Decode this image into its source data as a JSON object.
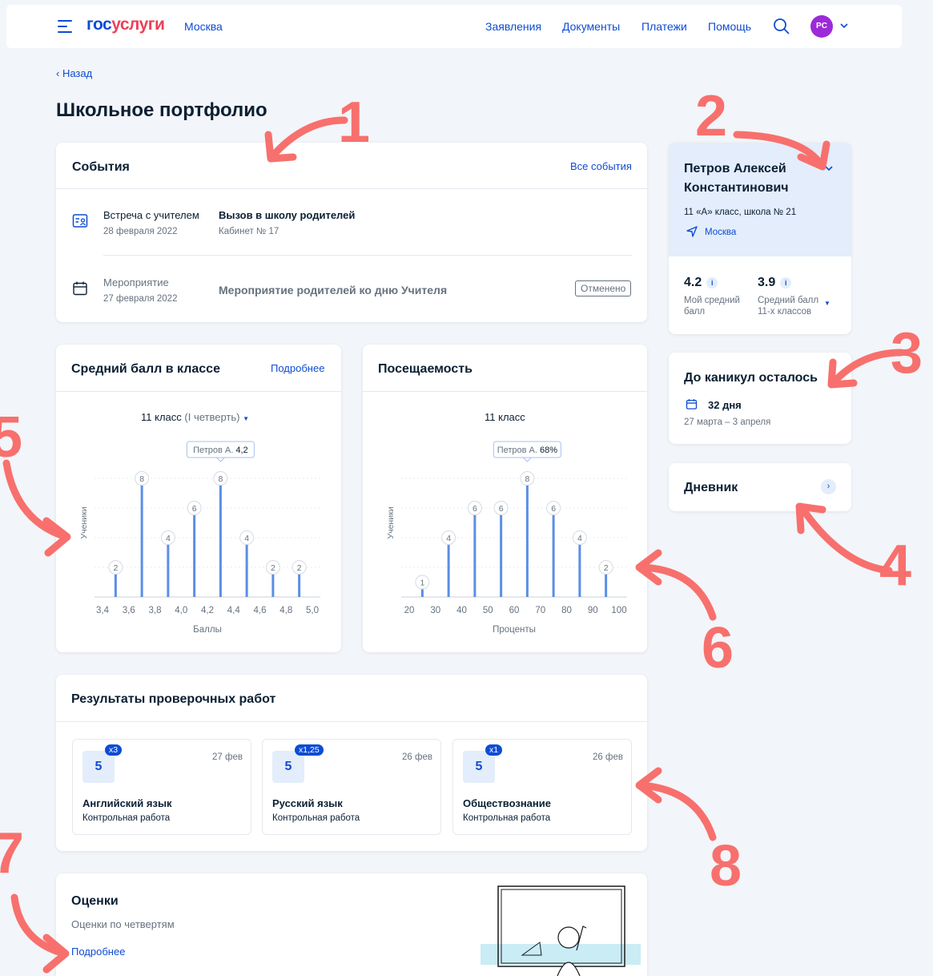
{
  "header": {
    "logo_part1": "гос",
    "logo_part2": "услуги",
    "city": "Москва",
    "nav": [
      "Заявления",
      "Документы",
      "Платежи",
      "Помощь"
    ],
    "avatar_initials": "PC"
  },
  "back_label": "Назад",
  "page_title": "Школьное портфолио",
  "events": {
    "title": "События",
    "all_link": "Все события",
    "items": [
      {
        "type": "Встреча с учителем",
        "date": "28 февраля 2022",
        "title": "Вызов в школу родителей",
        "sub": "Кабинет № 17"
      },
      {
        "type": "Мероприятие",
        "date": "27 февраля 2022",
        "title": "Мероприятие родителей ко дню Учителя",
        "status": "Отменено"
      }
    ]
  },
  "profile": {
    "name_line1": "Петров Алексей",
    "name_line2": "Константинович",
    "school": "11 «А» класс, школа № 21",
    "city": "Москва",
    "my_avg_value": "4.2",
    "my_avg_label_line1": "Мой средний",
    "my_avg_label_line2": "балл",
    "class_avg_value": "3.9",
    "class_avg_label_line1": "Средний балл",
    "class_avg_label_line2": "11-х классов"
  },
  "vacation": {
    "title": "До каникул осталось",
    "days": "32 дня",
    "range": "27 марта – 3 апреля"
  },
  "diary": {
    "title": "Дневник"
  },
  "grade_chart_card": {
    "title": "Средний балл в классе",
    "more": "Подробнее",
    "class_label": "11 класс",
    "quarter": "(I четверть)"
  },
  "attendance_card": {
    "title": "Посещаемость",
    "class_label": "11 класс"
  },
  "chart_data": [
    {
      "type": "bar",
      "ylabel": "Ученики",
      "xlabel": "Баллы",
      "x": [
        3.4,
        3.6,
        3.8,
        4.0,
        4.2,
        4.4,
        4.6,
        4.8,
        5.0
      ],
      "x_ticks": [
        "3,4",
        "3,6",
        "3,8",
        "4,0",
        "4,2",
        "4,4",
        "4,6",
        "4,8",
        "5,0"
      ],
      "bars": [
        {
          "x": 3.5,
          "value": 2
        },
        {
          "x": 3.7,
          "value": 8
        },
        {
          "x": 3.9,
          "value": 4
        },
        {
          "x": 4.1,
          "value": 6
        },
        {
          "x": 4.3,
          "value": 8
        },
        {
          "x": 4.5,
          "value": 4
        },
        {
          "x": 4.7,
          "value": 2
        },
        {
          "x": 4.9,
          "value": 2
        }
      ],
      "xlim": [
        3.4,
        5.0
      ],
      "ylim": [
        0,
        10
      ],
      "highlight": {
        "x": 4.3,
        "label": "Петров А.",
        "value": "4,2"
      }
    },
    {
      "type": "bar",
      "ylabel": "Ученики",
      "xlabel": "Проценты",
      "x": [
        20,
        30,
        40,
        50,
        60,
        70,
        80,
        90,
        100
      ],
      "x_ticks": [
        "20",
        "30",
        "40",
        "50",
        "60",
        "70",
        "80",
        "90",
        "100"
      ],
      "bars": [
        {
          "x": 25,
          "value": 1
        },
        {
          "x": 35,
          "value": 4
        },
        {
          "x": 45,
          "value": 6
        },
        {
          "x": 55,
          "value": 6
        },
        {
          "x": 65,
          "value": 8
        },
        {
          "x": 75,
          "value": 6
        },
        {
          "x": 85,
          "value": 4
        },
        {
          "x": 95,
          "value": 2
        }
      ],
      "xlim": [
        20,
        100
      ],
      "ylim": [
        0,
        10
      ],
      "highlight": {
        "x": 65,
        "label": "Петров А.",
        "value": "68%"
      }
    }
  ],
  "tests": {
    "title": "Результаты проверочных работ",
    "items": [
      {
        "grade": "5",
        "mult": "x3",
        "date": "27 фев",
        "subject": "Английский язык",
        "kind": "Контрольная работа"
      },
      {
        "grade": "5",
        "mult": "x1,25",
        "date": "26 фев",
        "subject": "Русский язык",
        "kind": "Контрольная работа"
      },
      {
        "grade": "5",
        "mult": "x1",
        "date": "26 фев",
        "subject": "Обществознание",
        "kind": "Контрольная работа"
      }
    ]
  },
  "grades": {
    "title": "Оценки",
    "sub": "Оценки по четвертям",
    "more": "Подробнее"
  },
  "annotations": [
    "1",
    "2",
    "3",
    "4",
    "5",
    "6",
    "7",
    "8"
  ],
  "colors": {
    "primary": "#0d4cd3",
    "accent": "#ee3f58",
    "annotation": "#f7706d",
    "bar": "#5b8ee6"
  }
}
